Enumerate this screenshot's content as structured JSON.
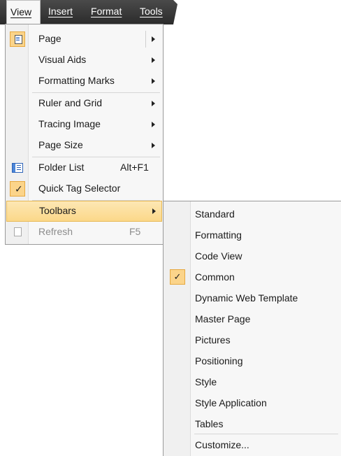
{
  "menubar": {
    "items": [
      {
        "name": "menu-view",
        "label": "View",
        "active": true
      },
      {
        "name": "menu-insert",
        "label": "Insert",
        "active": false
      },
      {
        "name": "menu-format",
        "label": "Format",
        "active": false
      },
      {
        "name": "menu-tools",
        "label": "Tools",
        "active": false
      }
    ]
  },
  "view_menu": {
    "items": [
      {
        "label": "Page",
        "submenu": true,
        "icon": "page-icon"
      },
      {
        "label": "Visual Aids",
        "submenu": true
      },
      {
        "label": "Formatting Marks",
        "submenu": true
      },
      {
        "label": "Ruler and Grid",
        "submenu": true
      },
      {
        "label": "Tracing Image",
        "submenu": true
      },
      {
        "label": "Page Size",
        "submenu": true
      },
      {
        "label": "Folder List",
        "shortcut": "Alt+F1",
        "icon": "folder-list-icon"
      },
      {
        "label": "Quick Tag Selector",
        "checked": true
      },
      {
        "label": "Toolbars",
        "submenu": true,
        "highlighted": true
      },
      {
        "label": "Refresh",
        "shortcut": "F5",
        "disabled": true,
        "icon": "refresh-icon"
      }
    ]
  },
  "toolbars_submenu": {
    "items": [
      {
        "label": "Standard"
      },
      {
        "label": "Formatting"
      },
      {
        "label": "Code View"
      },
      {
        "label": "Common",
        "checked": true
      },
      {
        "label": "Dynamic Web Template"
      },
      {
        "label": "Master Page"
      },
      {
        "label": "Pictures"
      },
      {
        "label": "Positioning"
      },
      {
        "label": "Style"
      },
      {
        "label": "Style Application"
      },
      {
        "label": "Tables"
      },
      {
        "label": "Customize..."
      }
    ]
  },
  "colors": {
    "menubar_bg": "#3a3a3a",
    "menu_bg": "#f7f7f7",
    "highlight_bg": "#fbd889",
    "highlight_border": "#e7b853",
    "icon_box_bg": "#fbd48a"
  }
}
